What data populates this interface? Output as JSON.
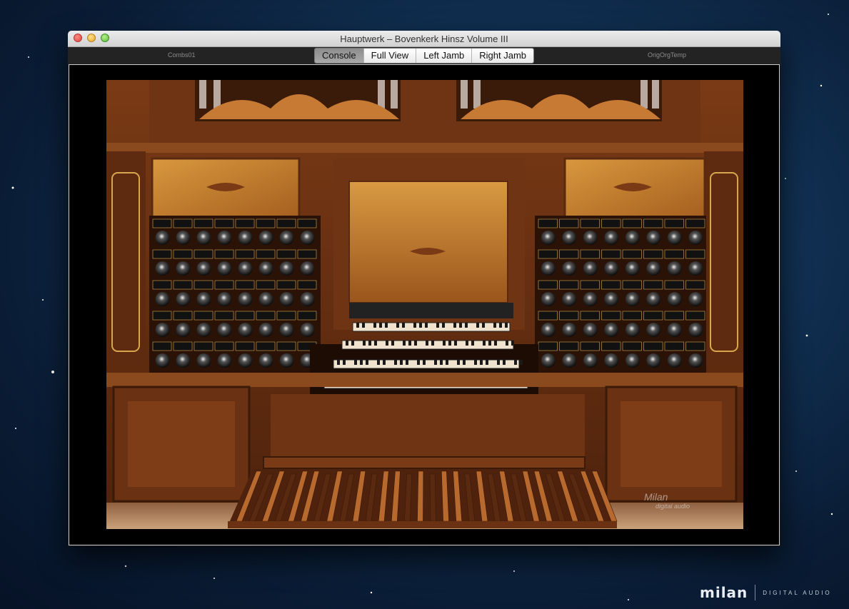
{
  "window": {
    "title": "Hauptwerk – Bovenkerk Hinsz Volume III",
    "left_label": "Combs01",
    "right_label": "OrigOrgTemp",
    "tabs": [
      {
        "label": "Console",
        "active": true
      },
      {
        "label": "Full View",
        "active": false
      },
      {
        "label": "Left Jamb",
        "active": false
      },
      {
        "label": "Right Jamb",
        "active": false
      }
    ]
  },
  "organ": {
    "watermark_main": "Milan",
    "watermark_sub": "digital audio"
  },
  "brand": {
    "logo": "milan",
    "subtitle": "DIGITAL AUDIO"
  },
  "colors": {
    "wood_dark": "#5a2a12",
    "wood_mid": "#8a4a20",
    "wood_light": "#c98a3c",
    "gold": "#d7a750",
    "label_black": "#111111"
  }
}
